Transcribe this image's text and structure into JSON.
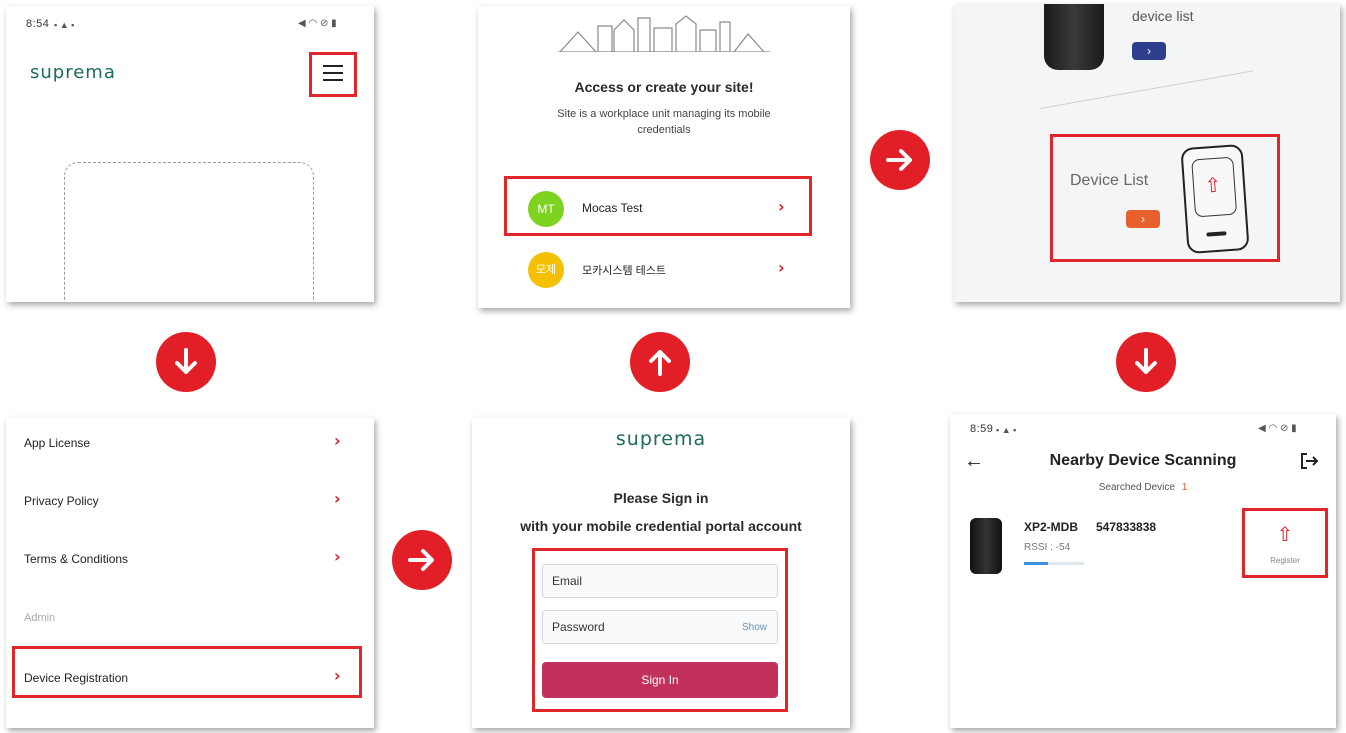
{
  "panel1": {
    "status_time": "8:54",
    "logo": "suprema",
    "menu_icon": "hamburger-menu-icon"
  },
  "panel2": {
    "heading": "Access or create your site!",
    "subtext_line1": "Site is a workplace unit managing its mobile",
    "subtext_line2": "credentials",
    "sites": [
      {
        "initials": "MT",
        "name": "Mocas Test",
        "color": "#7ed321"
      },
      {
        "initials": "모제",
        "name": "모카시스템 테스트",
        "color": "#f5c000"
      }
    ]
  },
  "panel3": {
    "device_list_top": "device list",
    "device_list_label": "Device List"
  },
  "panel4": {
    "menu_items": [
      "App License",
      "Privacy Policy",
      "Terms & Conditions"
    ],
    "section_label": "Admin",
    "device_registration": "Device Registration"
  },
  "panel5": {
    "logo": "suprema",
    "heading": "Please Sign in",
    "subheading": "with your mobile credential portal account",
    "email_placeholder": "Email",
    "password_placeholder": "Password",
    "show_label": "Show",
    "sign_in_label": "Sign In",
    "accent_color": "#c2315b"
  },
  "panel6": {
    "status_time": "8:59",
    "title": "Nearby Device Scanning",
    "searched_label": "Searched Device",
    "searched_count": "1",
    "device_name": "XP2-MDB",
    "device_id": "547833838",
    "rssi": "RSSI : -54",
    "register_label": "Register"
  },
  "colors": {
    "highlight": "#e0252b",
    "arrow": "#e21f26",
    "brand": "#1d6b5a"
  }
}
